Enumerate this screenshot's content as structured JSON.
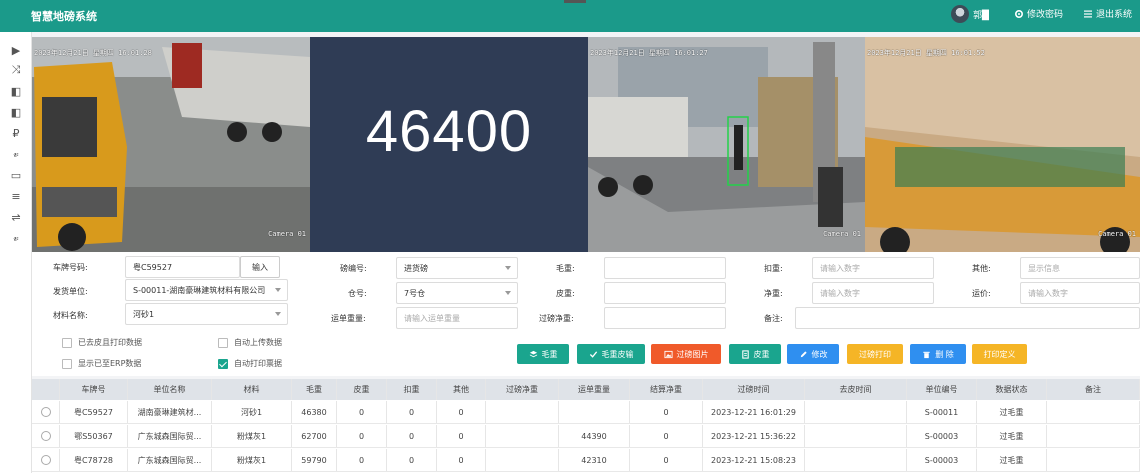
{
  "app": {
    "title": "智慧地磅系统",
    "user": "郭█",
    "change_password": "修改密码",
    "logout": "退出系统"
  },
  "cameras": [
    {
      "timestamp": "2023年12月21日 星期四 16:01:28",
      "label": "Camera 01"
    },
    {
      "timestamp": "2023年12月21日 星期四 16:01:27",
      "label": "Camera 01"
    },
    {
      "timestamp": "2023年12月21日 星期四 16:01:52",
      "label": "Camera 01"
    }
  ],
  "weight_display": "46400",
  "form": {
    "plate_label": "车牌号码:",
    "plate_value": "粤C59527",
    "input_button": "输入",
    "shipper_label": "发货单位:",
    "shipper_value": "S-00011-湖南豪琳建筑材料有限公司",
    "material_label": "材料名称:",
    "material_value": "河砂1",
    "scale_no_label": "磅编号:",
    "scale_no_value": "进货磅",
    "warehouse_label": "仓号:",
    "warehouse_value": "7号仓",
    "waybill_label": "运单重量:",
    "waybill_placeholder": "请输入运单重量",
    "gross_label": "毛重:",
    "tare_label": "皮重:",
    "net_label": "过磅净重:",
    "deduct_label": "扣重:",
    "deduct_placeholder": "请输入数字",
    "netweight_label": "净重:",
    "netweight_placeholder": "请输入数字",
    "remark_label": "备注:",
    "other_label": "其他:",
    "other_placeholder": "显示信息",
    "freight_label": "运价:",
    "freight_placeholder": "请输入数字",
    "checkboxes": [
      {
        "label": "已去皮且打印数据",
        "checked": false
      },
      {
        "label": "自动上传数据",
        "checked": false
      },
      {
        "label": "显示已至ERP数据",
        "checked": false
      },
      {
        "label": "自动打印票据",
        "checked": true
      }
    ]
  },
  "actions": [
    {
      "label": "毛重",
      "icon": "layers-icon",
      "color": "#1aa58e"
    },
    {
      "label": "毛重皮输",
      "icon": "check-icon",
      "color": "#1aa58e"
    },
    {
      "label": "过磅图片",
      "icon": "image-icon",
      "color": "#f05a2a"
    },
    {
      "label": "皮重",
      "icon": "document-icon",
      "color": "#1aa58e"
    },
    {
      "label": "修改",
      "icon": "pencil-icon",
      "color": "#2f8ff0"
    },
    {
      "label": "过磅打印",
      "icon": "",
      "color": "#f5b526"
    },
    {
      "label": "删 除",
      "icon": "trash-icon",
      "color": "#2f8ff0"
    },
    {
      "label": "打印定义",
      "icon": "",
      "color": "#f5b526"
    }
  ],
  "table": {
    "columns": [
      "车牌号",
      "单位名称",
      "材料",
      "毛重",
      "皮重",
      "扣重",
      "其他",
      "过磅净重",
      "运单重量",
      "结算净重",
      "过磅时间",
      "去皮时间",
      "单位编号",
      "数据状态",
      "备注"
    ],
    "rows": [
      [
        "粤C59527",
        "湖南豪琳建筑材...",
        "河砂1",
        "46380",
        "0",
        "0",
        "0",
        "",
        "",
        "0",
        "2023-12-21 16:01:29",
        "",
        "S-00011",
        "过毛重",
        ""
      ],
      [
        "鄂S50367",
        "广东城森国际贸...",
        "粉煤灰1",
        "62700",
        "0",
        "0",
        "0",
        "",
        "44390",
        "0",
        "2023-12-21 15:36:22",
        "",
        "S-00003",
        "过毛重",
        ""
      ],
      [
        "粤C78728",
        "广东城森国际贸...",
        "粉煤灰1",
        "59790",
        "0",
        "0",
        "0",
        "",
        "42310",
        "0",
        "2023-12-21 15:08:23",
        "",
        "S-00003",
        "过毛重",
        ""
      ]
    ]
  }
}
